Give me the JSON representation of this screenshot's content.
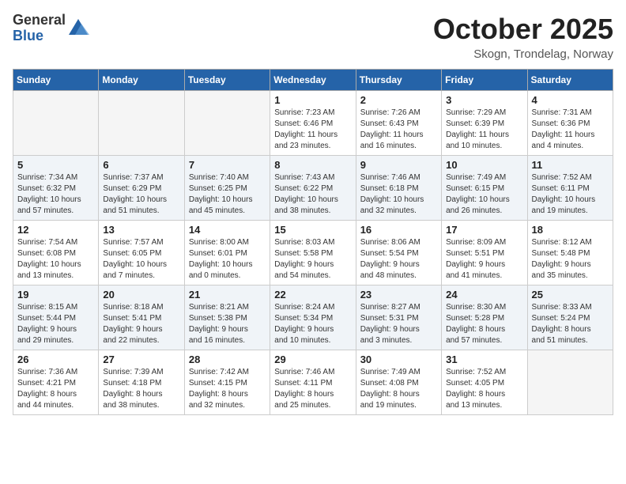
{
  "header": {
    "logo_general": "General",
    "logo_blue": "Blue",
    "month": "October 2025",
    "location": "Skogn, Trondelag, Norway"
  },
  "days_of_week": [
    "Sunday",
    "Monday",
    "Tuesday",
    "Wednesday",
    "Thursday",
    "Friday",
    "Saturday"
  ],
  "weeks": [
    [
      {
        "day": "",
        "info": ""
      },
      {
        "day": "",
        "info": ""
      },
      {
        "day": "",
        "info": ""
      },
      {
        "day": "1",
        "info": "Sunrise: 7:23 AM\nSunset: 6:46 PM\nDaylight: 11 hours\nand 23 minutes."
      },
      {
        "day": "2",
        "info": "Sunrise: 7:26 AM\nSunset: 6:43 PM\nDaylight: 11 hours\nand 16 minutes."
      },
      {
        "day": "3",
        "info": "Sunrise: 7:29 AM\nSunset: 6:39 PM\nDaylight: 11 hours\nand 10 minutes."
      },
      {
        "day": "4",
        "info": "Sunrise: 7:31 AM\nSunset: 6:36 PM\nDaylight: 11 hours\nand 4 minutes."
      }
    ],
    [
      {
        "day": "5",
        "info": "Sunrise: 7:34 AM\nSunset: 6:32 PM\nDaylight: 10 hours\nand 57 minutes."
      },
      {
        "day": "6",
        "info": "Sunrise: 7:37 AM\nSunset: 6:29 PM\nDaylight: 10 hours\nand 51 minutes."
      },
      {
        "day": "7",
        "info": "Sunrise: 7:40 AM\nSunset: 6:25 PM\nDaylight: 10 hours\nand 45 minutes."
      },
      {
        "day": "8",
        "info": "Sunrise: 7:43 AM\nSunset: 6:22 PM\nDaylight: 10 hours\nand 38 minutes."
      },
      {
        "day": "9",
        "info": "Sunrise: 7:46 AM\nSunset: 6:18 PM\nDaylight: 10 hours\nand 32 minutes."
      },
      {
        "day": "10",
        "info": "Sunrise: 7:49 AM\nSunset: 6:15 PM\nDaylight: 10 hours\nand 26 minutes."
      },
      {
        "day": "11",
        "info": "Sunrise: 7:52 AM\nSunset: 6:11 PM\nDaylight: 10 hours\nand 19 minutes."
      }
    ],
    [
      {
        "day": "12",
        "info": "Sunrise: 7:54 AM\nSunset: 6:08 PM\nDaylight: 10 hours\nand 13 minutes."
      },
      {
        "day": "13",
        "info": "Sunrise: 7:57 AM\nSunset: 6:05 PM\nDaylight: 10 hours\nand 7 minutes."
      },
      {
        "day": "14",
        "info": "Sunrise: 8:00 AM\nSunset: 6:01 PM\nDaylight: 10 hours\nand 0 minutes."
      },
      {
        "day": "15",
        "info": "Sunrise: 8:03 AM\nSunset: 5:58 PM\nDaylight: 9 hours\nand 54 minutes."
      },
      {
        "day": "16",
        "info": "Sunrise: 8:06 AM\nSunset: 5:54 PM\nDaylight: 9 hours\nand 48 minutes."
      },
      {
        "day": "17",
        "info": "Sunrise: 8:09 AM\nSunset: 5:51 PM\nDaylight: 9 hours\nand 41 minutes."
      },
      {
        "day": "18",
        "info": "Sunrise: 8:12 AM\nSunset: 5:48 PM\nDaylight: 9 hours\nand 35 minutes."
      }
    ],
    [
      {
        "day": "19",
        "info": "Sunrise: 8:15 AM\nSunset: 5:44 PM\nDaylight: 9 hours\nand 29 minutes."
      },
      {
        "day": "20",
        "info": "Sunrise: 8:18 AM\nSunset: 5:41 PM\nDaylight: 9 hours\nand 22 minutes."
      },
      {
        "day": "21",
        "info": "Sunrise: 8:21 AM\nSunset: 5:38 PM\nDaylight: 9 hours\nand 16 minutes."
      },
      {
        "day": "22",
        "info": "Sunrise: 8:24 AM\nSunset: 5:34 PM\nDaylight: 9 hours\nand 10 minutes."
      },
      {
        "day": "23",
        "info": "Sunrise: 8:27 AM\nSunset: 5:31 PM\nDaylight: 9 hours\nand 3 minutes."
      },
      {
        "day": "24",
        "info": "Sunrise: 8:30 AM\nSunset: 5:28 PM\nDaylight: 8 hours\nand 57 minutes."
      },
      {
        "day": "25",
        "info": "Sunrise: 8:33 AM\nSunset: 5:24 PM\nDaylight: 8 hours\nand 51 minutes."
      }
    ],
    [
      {
        "day": "26",
        "info": "Sunrise: 7:36 AM\nSunset: 4:21 PM\nDaylight: 8 hours\nand 44 minutes."
      },
      {
        "day": "27",
        "info": "Sunrise: 7:39 AM\nSunset: 4:18 PM\nDaylight: 8 hours\nand 38 minutes."
      },
      {
        "day": "28",
        "info": "Sunrise: 7:42 AM\nSunset: 4:15 PM\nDaylight: 8 hours\nand 32 minutes."
      },
      {
        "day": "29",
        "info": "Sunrise: 7:46 AM\nSunset: 4:11 PM\nDaylight: 8 hours\nand 25 minutes."
      },
      {
        "day": "30",
        "info": "Sunrise: 7:49 AM\nSunset: 4:08 PM\nDaylight: 8 hours\nand 19 minutes."
      },
      {
        "day": "31",
        "info": "Sunrise: 7:52 AM\nSunset: 4:05 PM\nDaylight: 8 hours\nand 13 minutes."
      },
      {
        "day": "",
        "info": ""
      }
    ]
  ]
}
